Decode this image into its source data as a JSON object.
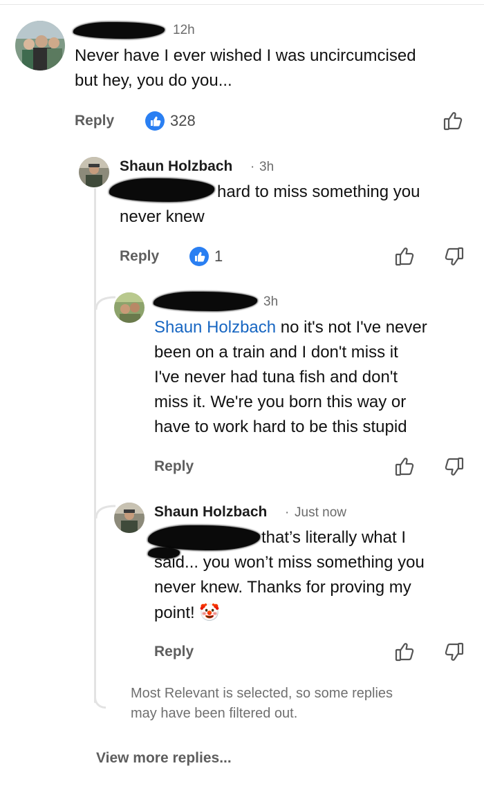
{
  "comment": {
    "time": "12h",
    "text_line1": "Never have I ever wished I was uncircumcised",
    "text_line2": "but hey, you do you...",
    "reply_label": "Reply",
    "like_count": "328"
  },
  "reply1": {
    "author": "Shaun Holzbach",
    "sep": "·",
    "time": "3h",
    "text_line1": "hard to miss something you",
    "text_line2": "never knew",
    "reply_label": "Reply",
    "like_count": "1"
  },
  "reply2": {
    "time": "3h",
    "mention": "Shaun Holzbach",
    "text_line1": " no it's not I've never",
    "text_line2": "been on a train and I don't miss it",
    "text_line3": "I've never had tuna fish and don't",
    "text_line4": "miss it. We're you born this way or",
    "text_line5": "have to work hard to be this stupid",
    "reply_label": "Reply"
  },
  "reply3": {
    "author": "Shaun Holzbach",
    "sep": "·",
    "time": "Just now",
    "text_line1": "that’s literally what I",
    "text_line2": "said... you won’t miss something you",
    "text_line3": "never knew. Thanks for proving my",
    "text_line4": "point!",
    "emoji": "🤡",
    "reply_label": "Reply"
  },
  "footer": {
    "note_line1": "Most Relevant is selected, so some replies",
    "note_line2": "may have been filtered out.",
    "view_more": "View more replies..."
  },
  "colors": {
    "like_blue": "#2a7ff2",
    "mention_blue": "#1766c2",
    "thread_line": "#e3e3e3"
  },
  "icons": [
    "like-reaction-icon",
    "thumbs-up-icon",
    "thumbs-down-icon"
  ]
}
